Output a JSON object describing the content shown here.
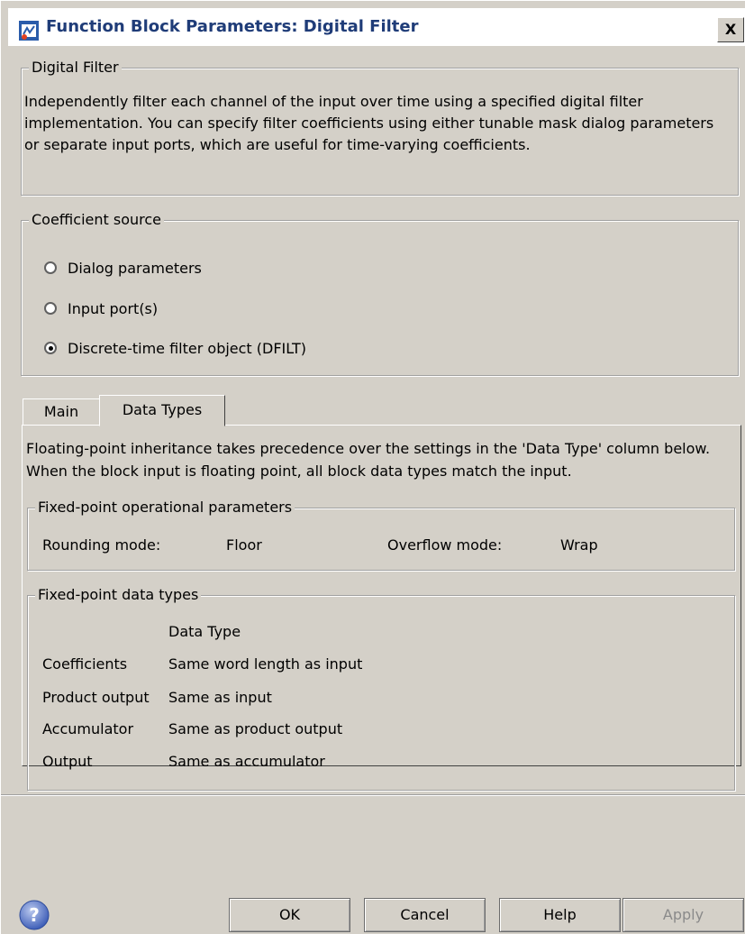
{
  "window": {
    "title": "Function Block Parameters: Digital Filter",
    "close_label": "X"
  },
  "block_group": {
    "legend": "Digital Filter",
    "description": "Independently filter each channel of the input over time using a specified digital filter implementation. You can specify filter coefficients using either tunable mask dialog parameters or separate input ports, which are useful for time-varying coefficients."
  },
  "coefficient_source": {
    "legend": "Coefficient source",
    "options": [
      {
        "label": "Dialog parameters",
        "checked": false
      },
      {
        "label": "Input port(s)",
        "checked": false
      },
      {
        "label": "Discrete-time filter object (DFILT)",
        "checked": true
      }
    ]
  },
  "tabs": [
    {
      "label": "Main",
      "active": false
    },
    {
      "label": "Data Types",
      "active": true
    }
  ],
  "data_types": {
    "info": "Floating-point inheritance takes precedence over the settings in the 'Data Type' column below. When the block input is floating point, all block data types match the input.",
    "operational": {
      "legend": "Fixed-point operational parameters",
      "rounding_label": "Rounding mode:",
      "rounding_value": "Floor",
      "overflow_label": "Overflow mode:",
      "overflow_value": "Wrap"
    },
    "fixed_point": {
      "legend": "Fixed-point data types",
      "column_header": "Data Type",
      "rows": [
        {
          "name": "Coefficients",
          "value": "Same word length as input"
        },
        {
          "name": "Product output",
          "value": "Same as input"
        },
        {
          "name": "Accumulator",
          "value": "Same as product output"
        },
        {
          "name": "Output",
          "value": "Same as accumulator"
        }
      ]
    }
  },
  "buttons": {
    "ok": "OK",
    "cancel": "Cancel",
    "help": "Help",
    "apply": "Apply"
  }
}
